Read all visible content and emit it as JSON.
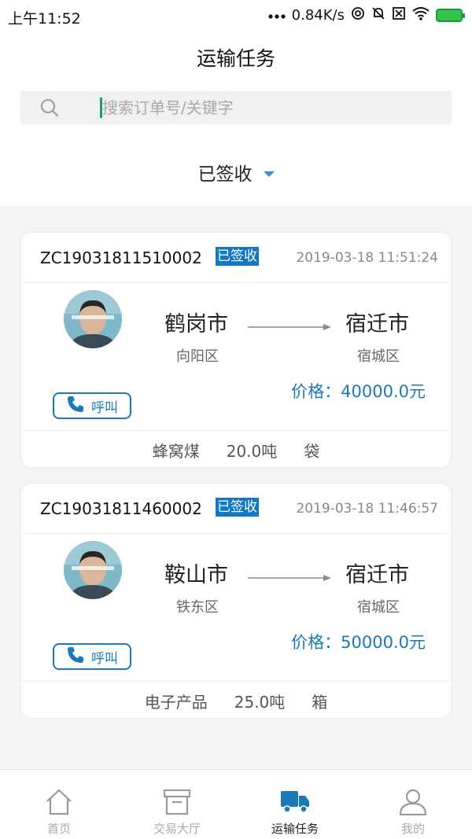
{
  "status_bar": {
    "time": "上午11:52",
    "network_speed": "0.84K/s",
    "icons": [
      "signal-dots-icon",
      "hotspot-icon",
      "mute-icon",
      "sim-off-icon",
      "wifi-icon",
      "battery-charging-icon"
    ]
  },
  "header": {
    "title": "运输任务"
  },
  "search": {
    "placeholder": "搜索订单号/关键字",
    "value": ""
  },
  "filter": {
    "label": "已签收"
  },
  "orders": [
    {
      "order_no": "ZC19031811510002",
      "status": "已签收",
      "datetime": "2019-03-18 11:51:24",
      "origin_city": "鹤岗市",
      "origin_district": "向阳区",
      "dest_city": "宿迁市",
      "dest_district": "宿城区",
      "price_label": "价格：",
      "price_value": "40000.0元",
      "call_label": "呼叫",
      "goods": "蜂窝煤",
      "weight": "20.0吨",
      "package": "袋"
    },
    {
      "order_no": "ZC19031811460002",
      "status": "已签收",
      "datetime": "2019-03-18 11:46:57",
      "origin_city": "鞍山市",
      "origin_district": "铁东区",
      "dest_city": "宿迁市",
      "dest_district": "宿城区",
      "price_label": "价格：",
      "price_value": "50000.0元",
      "call_label": "呼叫",
      "goods": "电子产品",
      "weight": "25.0吨",
      "package": "箱"
    }
  ],
  "tabbar": {
    "items": [
      {
        "label": "首页",
        "icon": "home-icon",
        "active": false
      },
      {
        "label": "交易大厅",
        "icon": "archive-box-icon",
        "active": false
      },
      {
        "label": "运输任务",
        "icon": "truck-icon",
        "active": true
      },
      {
        "label": "我的",
        "icon": "user-icon",
        "active": false
      }
    ]
  },
  "colors": {
    "accent": "#1a79b8",
    "badge": "#1278c4",
    "filter_caret": "#3f8fd0"
  }
}
